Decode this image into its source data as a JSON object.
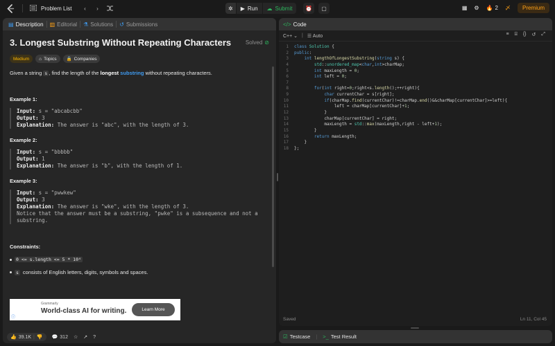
{
  "topbar": {
    "logo_icon": "leetcode-logo-icon",
    "problem_list_label": "Problem List",
    "run_label": "Run",
    "submit_label": "Submit",
    "streak_count": "2",
    "premium_label": "Premium"
  },
  "tabs": [
    {
      "label": "Description",
      "icon": "description-icon"
    },
    {
      "label": "Editorial",
      "icon": "editorial-icon"
    },
    {
      "label": "Solutions",
      "icon": "solutions-icon"
    },
    {
      "label": "Submissions",
      "icon": "submissions-icon"
    }
  ],
  "problem": {
    "title": "3. Longest Substring Without Repeating Characters",
    "solved_label": "Solved",
    "difficulty": "Medium",
    "topics_label": "Topics",
    "companies_label": "Companies",
    "desc_prefix": "Given a string ",
    "desc_var": "s",
    "desc_mid": ", find the length of the ",
    "desc_bold": "longest",
    "desc_link": "substring",
    "desc_suffix": " without repeating characters."
  },
  "examples": [
    {
      "title": "Example 1:",
      "input": "s = \"abcabcbb\"",
      "output": "3",
      "explanation": "The answer is \"abc\", with the length of 3.",
      "note1": "",
      "note2": ""
    },
    {
      "title": "Example 2:",
      "input": "s = \"bbbbb\"",
      "output": "1",
      "explanation": "The answer is \"b\", with the length of 1.",
      "note1": "",
      "note2": ""
    },
    {
      "title": "Example 3:",
      "input": "s = \"pwwkew\"",
      "output": "3",
      "explanation": "The answer is \"wke\", with the length of 3.",
      "note1": "Notice that the answer must be a substring, \"pwke\" is a subsequence and not a",
      "note2": "substring."
    }
  ],
  "labels": {
    "input": "Input:",
    "output": "Output:",
    "explanation": "Explanation:"
  },
  "constraints": {
    "title": "Constraints:",
    "c1": "0 <= s.length <= 5 * 10⁴",
    "c2_code": "s",
    "c2_text": " consists of English letters, digits, symbols and spaces."
  },
  "ad": {
    "brand": "Grammarly",
    "headline": "World-class AI for writing.",
    "button": "Learn More"
  },
  "bottom": {
    "likes": "39.1K",
    "comments": "312"
  },
  "code": {
    "header": "Code",
    "language": "C++",
    "mode": "Auto",
    "lines": [
      "class Solution {",
      "public:",
      "    int lengthOfLongestSubstring(string s) {",
      "        std::unordered_map<char,int>charMap;",
      "        int maxLength = 0;",
      "        int left = 0;",
      "",
      "        for(int right=0;right<s.length();++right){",
      "            char currentChar = s[right];",
      "            if(charMap.find(currentChar)!=charMap.end()&&charMap[currentChar]>=left){",
      "                left = charMap[currentChar]+1;",
      "            }",
      "            charMap[currentChar] = right;",
      "            maxLength = std::max(maxLength,right - left+1);",
      "        }",
      "        return maxLength;",
      "    }",
      "};"
    ],
    "status": "Saved",
    "cursor": "Ln 11, Col 45"
  },
  "testpanel": {
    "testcase_label": "Testcase",
    "result_label": "Test Result"
  }
}
